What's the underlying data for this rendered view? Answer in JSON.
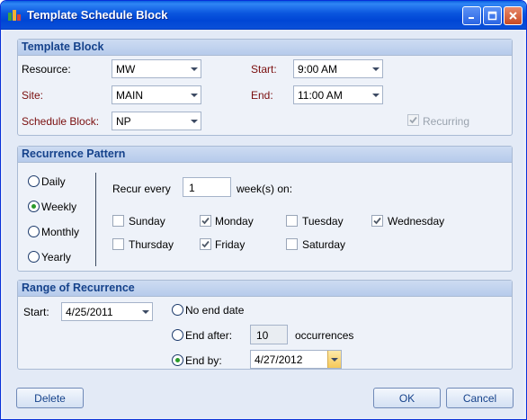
{
  "window": {
    "title": "Template Schedule Block"
  },
  "template_block": {
    "header": "Template Block",
    "resource_label": "Resource:",
    "resource_value": "MW",
    "site_label": "Site:",
    "site_value": "MAIN",
    "schedule_block_label": "Schedule Block:",
    "schedule_block_value": "NP",
    "start_label": "Start:",
    "start_value": "9:00 AM",
    "end_label": "End:",
    "end_value": "11:00 AM",
    "recurring_label": "Recurring",
    "recurring_checked": true
  },
  "recurrence_pattern": {
    "header": "Recurrence Pattern",
    "options": [
      {
        "label": "Daily",
        "selected": false
      },
      {
        "label": "Weekly",
        "selected": true
      },
      {
        "label": "Monthly",
        "selected": false
      },
      {
        "label": "Yearly",
        "selected": false
      }
    ],
    "recur_every_label": "Recur every",
    "recur_every_value": "1",
    "weeks_on_label": "week(s) on:",
    "days": [
      {
        "label": "Sunday",
        "checked": false
      },
      {
        "label": "Monday",
        "checked": true
      },
      {
        "label": "Tuesday",
        "checked": false
      },
      {
        "label": "Wednesday",
        "checked": true
      },
      {
        "label": "Thursday",
        "checked": false
      },
      {
        "label": "Friday",
        "checked": true
      },
      {
        "label": "Saturday",
        "checked": false
      }
    ]
  },
  "range_of_recurrence": {
    "header": "Range of Recurrence",
    "start_label": "Start:",
    "start_value": "4/25/2011",
    "no_end_label": "No end date",
    "end_after_label": "End after:",
    "end_after_value": "10",
    "occurrences_label": "occurrences",
    "end_by_label": "End by:",
    "end_by_value": "4/27/2012",
    "selected": "end_by"
  },
  "buttons": {
    "delete": "Delete",
    "ok": "OK",
    "cancel": "Cancel"
  },
  "colors": {
    "title_bar": "#0a55de",
    "group_header_text": "#15428b",
    "required_label": "#7a0e0e",
    "highlight_arrow": "#f6c95a"
  }
}
